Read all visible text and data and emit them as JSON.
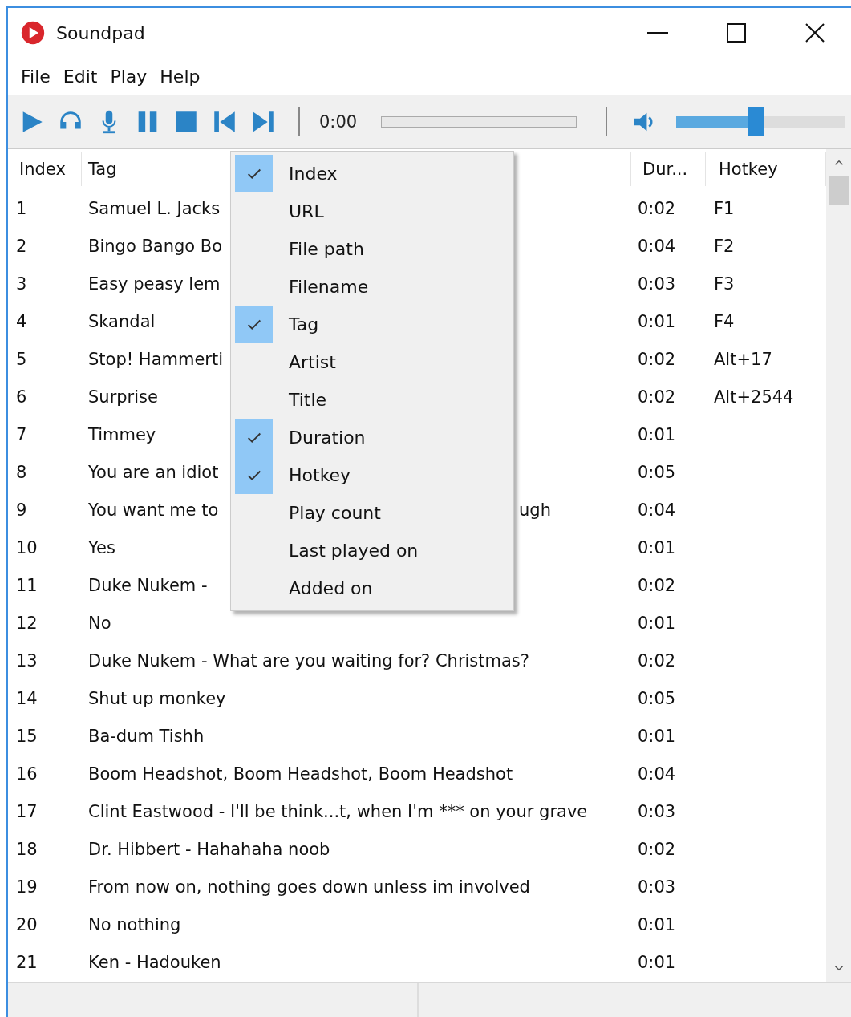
{
  "window": {
    "title": "Soundpad"
  },
  "menu_bar": [
    "File",
    "Edit",
    "Play",
    "Help"
  ],
  "player": {
    "time": "0:00",
    "volume": {
      "level": 0.47
    }
  },
  "table": {
    "columns": [
      "Index",
      "Tag",
      "Dur...",
      "Hotkey"
    ],
    "rows": [
      {
        "index": "1",
        "tag": "Samuel L. Jacks",
        "duration": "0:02",
        "hotkey": "F1"
      },
      {
        "index": "2",
        "tag": "Bingo Bango Bo",
        "duration": "0:04",
        "hotkey": "F2"
      },
      {
        "index": "3",
        "tag": "Easy peasy lem",
        "duration": "0:03",
        "hotkey": "F3"
      },
      {
        "index": "4",
        "tag": "Skandal",
        "duration": "0:01",
        "hotkey": "F4"
      },
      {
        "index": "5",
        "tag": "Stop! Hammerti",
        "duration": "0:02",
        "hotkey": "Alt+17"
      },
      {
        "index": "6",
        "tag": "Surprise",
        "duration": "0:02",
        "hotkey": "Alt+2544"
      },
      {
        "index": "7",
        "tag": "Timmey",
        "duration": "0:01"
      },
      {
        "index": "8",
        "tag": "You are an idiot",
        "duration": "0:05"
      },
      {
        "index": "9",
        "tag": "You want me to",
        "tag_tail": "ugh",
        "duration": "0:04"
      },
      {
        "index": "10",
        "tag": "Yes",
        "duration": "0:01"
      },
      {
        "index": "11",
        "tag": "Duke Nukem -",
        "duration": "0:02"
      },
      {
        "index": "12",
        "tag": "No",
        "duration": "0:01"
      },
      {
        "index": "13",
        "tag": "Duke Nukem - What are you waiting for? Christmas?",
        "duration": "0:02"
      },
      {
        "index": "14",
        "tag": "Shut up monkey",
        "duration": "0:05"
      },
      {
        "index": "15",
        "tag": "Ba-dum Tishh",
        "duration": "0:01"
      },
      {
        "index": "16",
        "tag": "Boom Headshot, Boom Headshot, Boom Headshot",
        "duration": "0:04"
      },
      {
        "index": "17",
        "tag": "Clint Eastwood - I'll be think...t, when I'm *** on your grave",
        "duration": "0:03"
      },
      {
        "index": "18",
        "tag": "Dr. Hibbert - Hahahaha noob",
        "duration": "0:02"
      },
      {
        "index": "19",
        "tag": "From now on, nothing goes down unless im involved",
        "duration": "0:03"
      },
      {
        "index": "20",
        "tag": "No nothing",
        "duration": "0:01"
      },
      {
        "index": "21",
        "tag": "Ken - Hadouken",
        "duration": "0:01"
      }
    ]
  },
  "context_menu": [
    {
      "label": "Index",
      "checked": true
    },
    {
      "label": "URL",
      "checked": false
    },
    {
      "label": "File path",
      "checked": false
    },
    {
      "label": "Filename",
      "checked": false
    },
    {
      "label": "Tag",
      "checked": true
    },
    {
      "label": "Artist",
      "checked": false
    },
    {
      "label": "Title",
      "checked": false
    },
    {
      "label": "Duration",
      "checked": true
    },
    {
      "label": "Hotkey",
      "checked": true
    },
    {
      "label": "Play count",
      "checked": false
    },
    {
      "label": "Last played on",
      "checked": false
    },
    {
      "label": "Added on",
      "checked": false
    }
  ]
}
